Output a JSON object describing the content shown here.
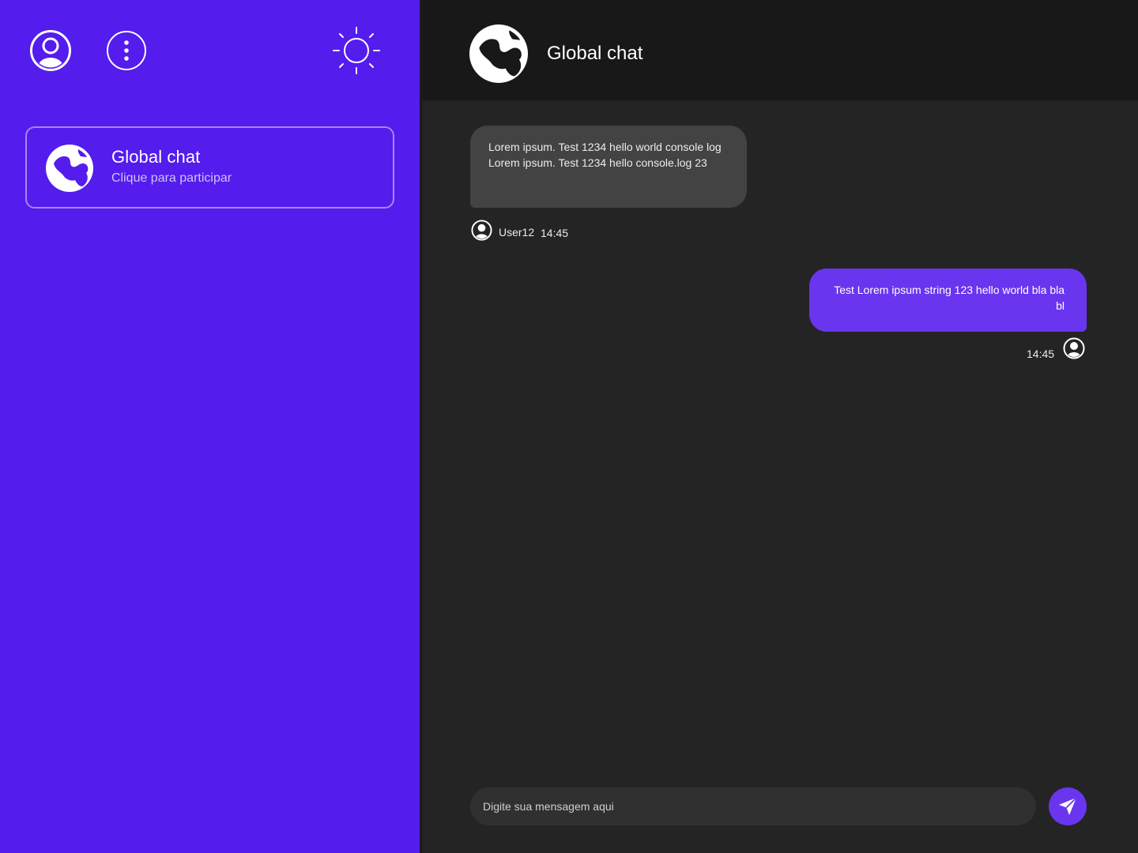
{
  "colors": {
    "sidebar_bg": "#541ced",
    "chat_bg": "#242424",
    "header_bg": "#181818",
    "incoming_bubble": "#434343",
    "outgoing_bubble": "#6a35ee",
    "accent": "#6a35ee",
    "card_border": "#a885f7"
  },
  "sidebar": {
    "top_icons": [
      "user-circle-icon",
      "more-vertical-icon",
      "sun-icon"
    ],
    "chats": [
      {
        "title": "Global chat",
        "subtitle": "Clique para participar",
        "icon": "globe-icon"
      }
    ]
  },
  "header": {
    "title": "Global chat",
    "icon": "globe-icon"
  },
  "messages": [
    {
      "direction": "incoming",
      "text": "Lorem ipsum. Test 1234 hello  world console log Lorem ipsum. Test 1234 hello  console.log 23",
      "user": "User12",
      "time": "14:45",
      "icon": "user-circle-icon"
    },
    {
      "direction": "outgoing",
      "text": "Test Lorem ipsum string 123 hello world bla bla bl",
      "time": "14:45",
      "icon": "user-circle-icon"
    }
  ],
  "composer": {
    "placeholder": "Digite sua mensagem aqui",
    "value": "",
    "send_icon": "send-icon"
  }
}
